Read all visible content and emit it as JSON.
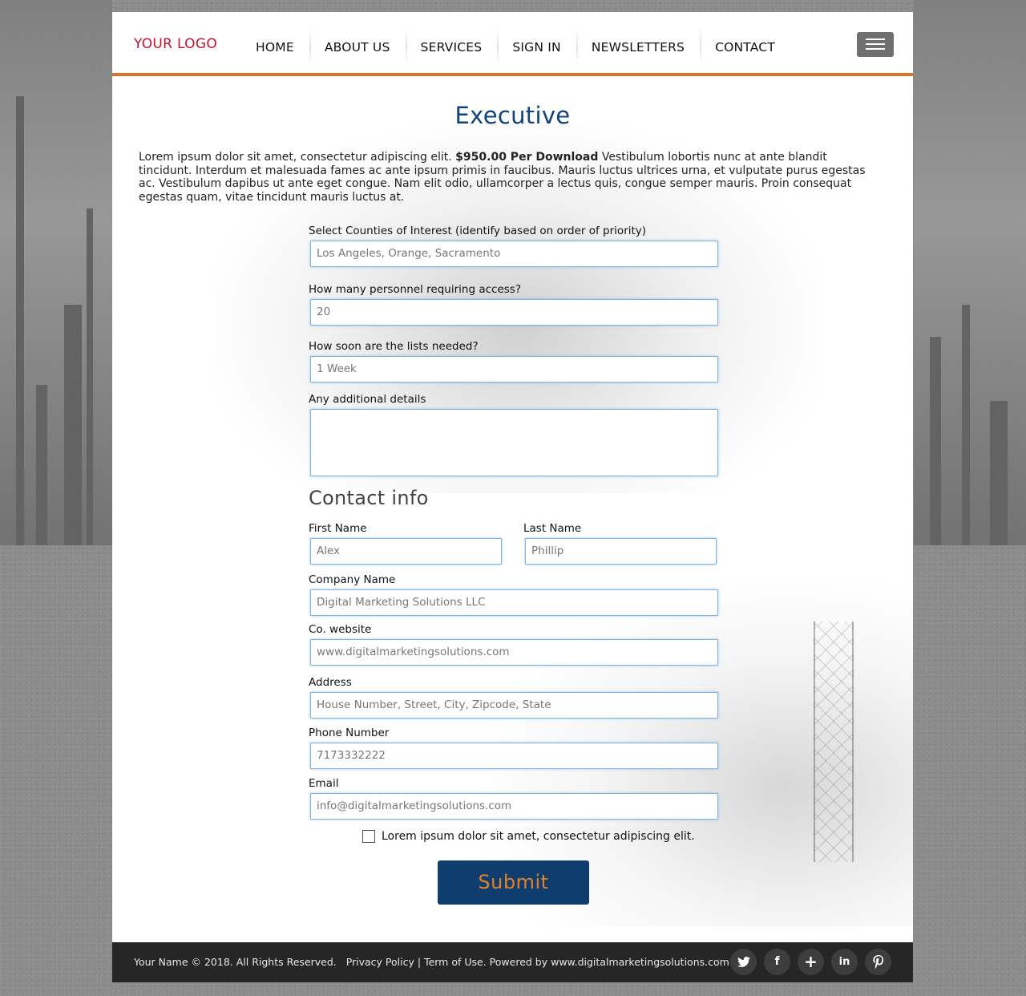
{
  "header": {
    "logo": "YOUR LOGO",
    "nav": [
      "HOME",
      "ABOUT US",
      "SERVICES",
      "SIGN IN",
      "NEWSLETTERS",
      "CONTACT"
    ],
    "menu_icon": "hamburger-menu-icon"
  },
  "main": {
    "title": "Executive",
    "intro_before": "Lorem ipsum dolor sit amet, consectetur adipiscing elit. ",
    "intro_price": "$950.00 Per Download",
    "intro_after": " Vestibulum lobortis nunc at ante blandit tincidunt. Interdum et malesuada fames ac ante ipsum primis in faucibus. Mauris luctus ultrices urna, et vulputate purus egestas ac. Vestibulum dapibus ut ante eget congue. Nam elit odio, ullamcorper a lectus quis, congue semper mauris. Proin consequat egestas quam, vitae tincidunt mauris luctus at."
  },
  "form": {
    "counties_label": "Select Counties of Interest (identify based on order of priority)",
    "counties_placeholder": "Los Angeles, Orange, Sacramento",
    "personnel_label": "How many personnel requiring access?",
    "personnel_placeholder": "20",
    "soon_label": "How soon are the lists needed?",
    "soon_placeholder": "1 Week",
    "details_label": "Any additional details",
    "details_placeholder": "",
    "contact_title": "Contact info",
    "first_name_label": "First Name",
    "first_name_placeholder": "Alex",
    "last_name_label": "Last Name",
    "last_name_placeholder": "Phillip",
    "company_label": "Company Name",
    "company_placeholder": "Digital Marketing Solutions LLC",
    "website_label": "Co. website",
    "website_placeholder": "www.digitalmarketingsolutions.com",
    "address_label": "Address",
    "address_placeholder": "House Number, Street, City, Zipcode, State",
    "phone_label": "Phone Number",
    "phone_placeholder": "7173332222",
    "email_label": "Email",
    "email_placeholder": "info@digitalmarketingsolutions.com",
    "checkbox_label": "Lorem ipsum dolor sit amet, consectetur adipiscing elit.",
    "checkbox_checked": false,
    "submit_label": "Submit"
  },
  "footer": {
    "copyright": "Your Name © 2018. All Rights Reserved.",
    "privacy": "Privacy Policy",
    "separator": "|",
    "terms": "Term of Use.",
    "powered": "Powered by www.digitalmarketingsolutions.com",
    "social_icons": [
      "twitter-icon",
      "facebook-icon",
      "google-plus-icon",
      "linkedin-icon",
      "pinterest-icon"
    ]
  },
  "colors": {
    "logo": "#c4122f",
    "accent_bar": "#d7742e",
    "title": "#10437a",
    "submit_bg": "#0f3d6e",
    "submit_text": "#e0822a",
    "footer_bg": "#262626"
  }
}
